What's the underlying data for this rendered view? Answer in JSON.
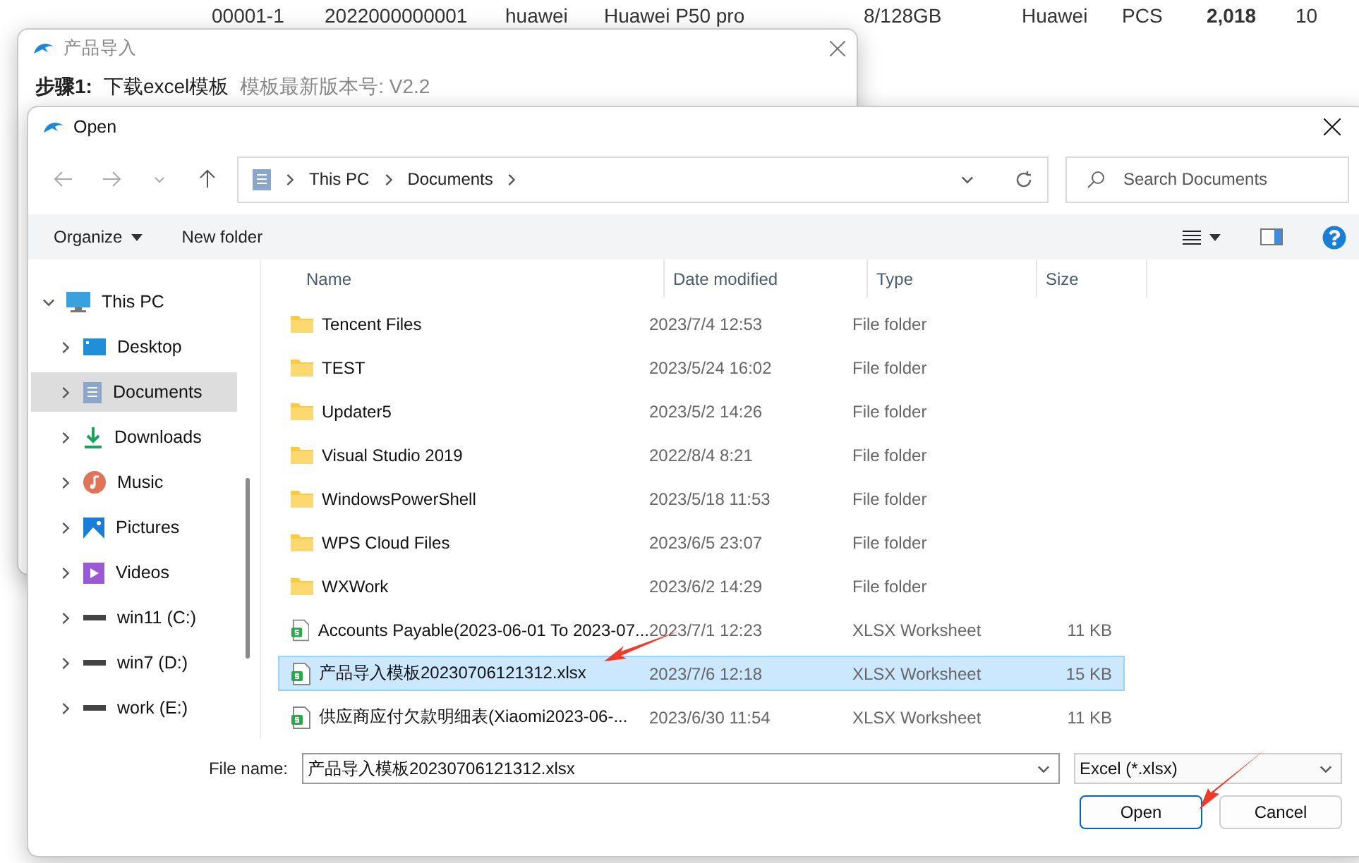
{
  "background_table": {
    "row": [
      "00001-1",
      "2022000000001",
      "huawei",
      "Huawei P50 pro",
      "8/128GB",
      "Huawei",
      "PCS",
      "2,018",
      "10"
    ]
  },
  "import_dialog": {
    "title": "产品导入",
    "step_label": "步骤1:",
    "step_action": "下载excel模板",
    "version_label": "模板最新版本号: V2.2"
  },
  "open_dialog": {
    "title": "Open",
    "breadcrumb": [
      "This PC",
      "Documents"
    ],
    "search": {
      "placeholder": "Search Documents"
    },
    "toolbar": {
      "organize": "Organize",
      "new_folder": "New folder"
    },
    "nav_tree": [
      {
        "label": "This PC",
        "expanded": true,
        "selected": false,
        "children": [
          {
            "label": "Desktop",
            "expanded": false,
            "selected": false
          },
          {
            "label": "Documents",
            "expanded": false,
            "selected": true
          },
          {
            "label": "Downloads",
            "expanded": false,
            "selected": false
          },
          {
            "label": "Music",
            "expanded": false,
            "selected": false
          },
          {
            "label": "Pictures",
            "expanded": false,
            "selected": false
          },
          {
            "label": "Videos",
            "expanded": false,
            "selected": false
          },
          {
            "label": "win11 (C:)",
            "expanded": false,
            "selected": false
          },
          {
            "label": "win7 (D:)",
            "expanded": false,
            "selected": false
          },
          {
            "label": "work (E:)",
            "expanded": false,
            "selected": false
          }
        ]
      }
    ],
    "columns": [
      "Name",
      "Date modified",
      "Type",
      "Size"
    ],
    "files": [
      {
        "kind": "folder",
        "name": "Tencent Files",
        "date": "2023/7/4 12:53",
        "type": "File folder",
        "selected": false
      },
      {
        "kind": "folder",
        "name": "TEST",
        "date": "2023/5/24 16:02",
        "type": "File folder",
        "selected": false
      },
      {
        "kind": "folder",
        "name": "Updater5",
        "date": "2023/5/2 14:26",
        "type": "File folder",
        "selected": false
      },
      {
        "kind": "folder",
        "name": "Visual Studio 2019",
        "date": "2022/8/4 8:21",
        "type": "File folder",
        "selected": false
      },
      {
        "kind": "folder",
        "name": "WindowsPowerShell",
        "date": "2023/5/18 11:53",
        "type": "File folder",
        "selected": false
      },
      {
        "kind": "folder",
        "name": "WPS Cloud Files",
        "date": "2023/6/5 23:07",
        "type": "File folder",
        "selected": false
      },
      {
        "kind": "folder",
        "name": "WXWork",
        "date": "2023/6/2 14:29",
        "type": "File folder",
        "selected": false
      },
      {
        "kind": "worksheet",
        "name": "Accounts Payable(2023-06-01 To 2023-07...",
        "date": "2023/7/1 12:23",
        "type": "XLSX Worksheet",
        "size": "11 KB",
        "selected": false
      },
      {
        "kind": "worksheet",
        "name": "产品导入模板20230706121312.xlsx",
        "date": "2023/7/6 12:18",
        "type": "XLSX Worksheet",
        "size": "15 KB",
        "selected": true
      },
      {
        "kind": "worksheet",
        "name": "供应商应付欠款明细表(Xiaomi2023-06-...",
        "date": "2023/6/30 11:54",
        "type": "XLSX Worksheet",
        "size": "11 KB",
        "selected": false
      }
    ],
    "file_name_label": "File name:",
    "file_name": "产品导入模板20230706121312.xlsx",
    "filter": "Excel (*.xlsx)",
    "buttons": {
      "open": "Open",
      "cancel": "Cancel"
    }
  }
}
